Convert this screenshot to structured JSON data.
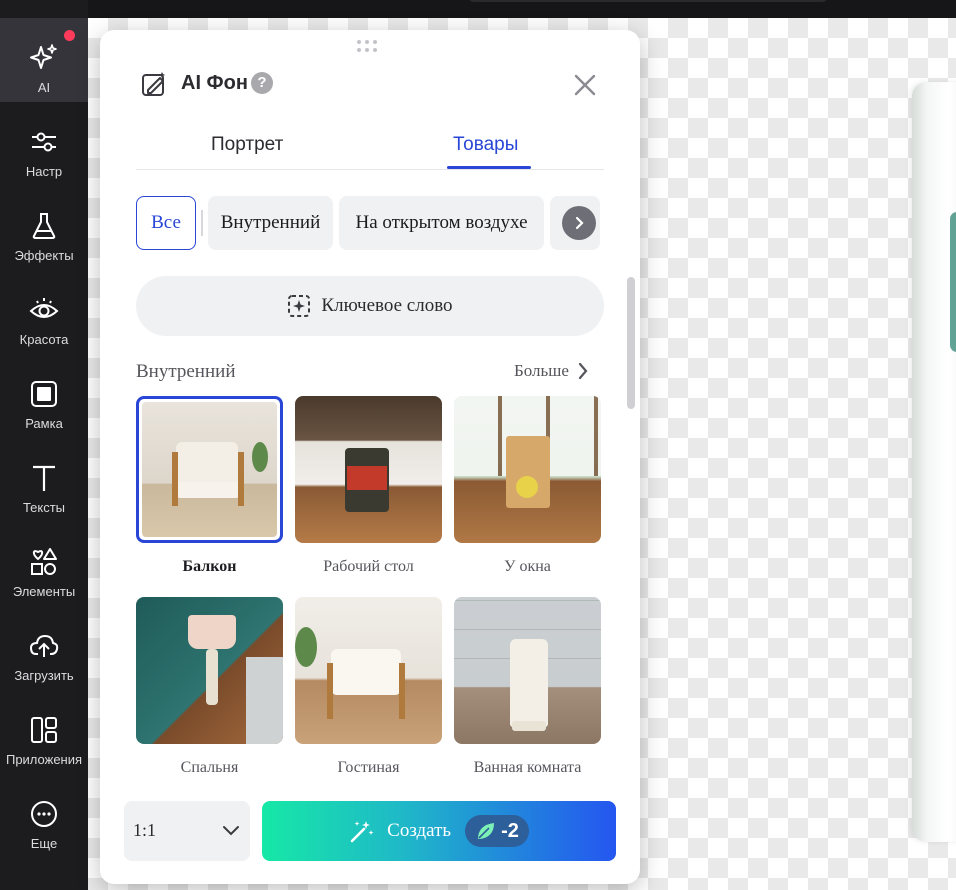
{
  "sidebar": {
    "items": [
      {
        "label": "AI",
        "icon": "sparkle-icon"
      },
      {
        "label": "Настр",
        "icon": "sliders-icon"
      },
      {
        "label": "Эффекты",
        "icon": "flask-icon"
      },
      {
        "label": "Красота",
        "icon": "eye-icon"
      },
      {
        "label": "Рамка",
        "icon": "frame-icon"
      },
      {
        "label": "Тексты",
        "icon": "text-icon"
      },
      {
        "label": "Элементы",
        "icon": "shapes-icon"
      },
      {
        "label": "Загрузить",
        "icon": "upload-cloud-icon"
      },
      {
        "label": "Приложения",
        "icon": "apps-icon"
      },
      {
        "label": "Еще",
        "icon": "more-icon"
      }
    ]
  },
  "panel": {
    "title": "AI Фон",
    "help": "?",
    "tabs": [
      "Портрет",
      "Товары"
    ],
    "active_tab": "Товары",
    "chips": [
      "Все",
      "Внутренний",
      "На открытом воздухе"
    ],
    "keyword_label": "Ключевое слово",
    "section_title": "Внутренний",
    "more_label": "Больше",
    "thumbnails": [
      {
        "caption": "Балкон",
        "selected": true
      },
      {
        "caption": "Рабочий стол",
        "selected": false
      },
      {
        "caption": "У окна",
        "selected": false
      },
      {
        "caption": "Спальня",
        "selected": false
      },
      {
        "caption": "Гостиная",
        "selected": false
      },
      {
        "caption": "Ванная комната",
        "selected": false
      }
    ],
    "ratio_value": "1:1",
    "create_label": "Создать",
    "create_cost": "-2"
  },
  "colors": {
    "accent": "#2946d6",
    "notification_dot": "#ff3b5c",
    "create_gradient_start": "#16e8a6",
    "create_gradient_end": "#2456f0"
  }
}
